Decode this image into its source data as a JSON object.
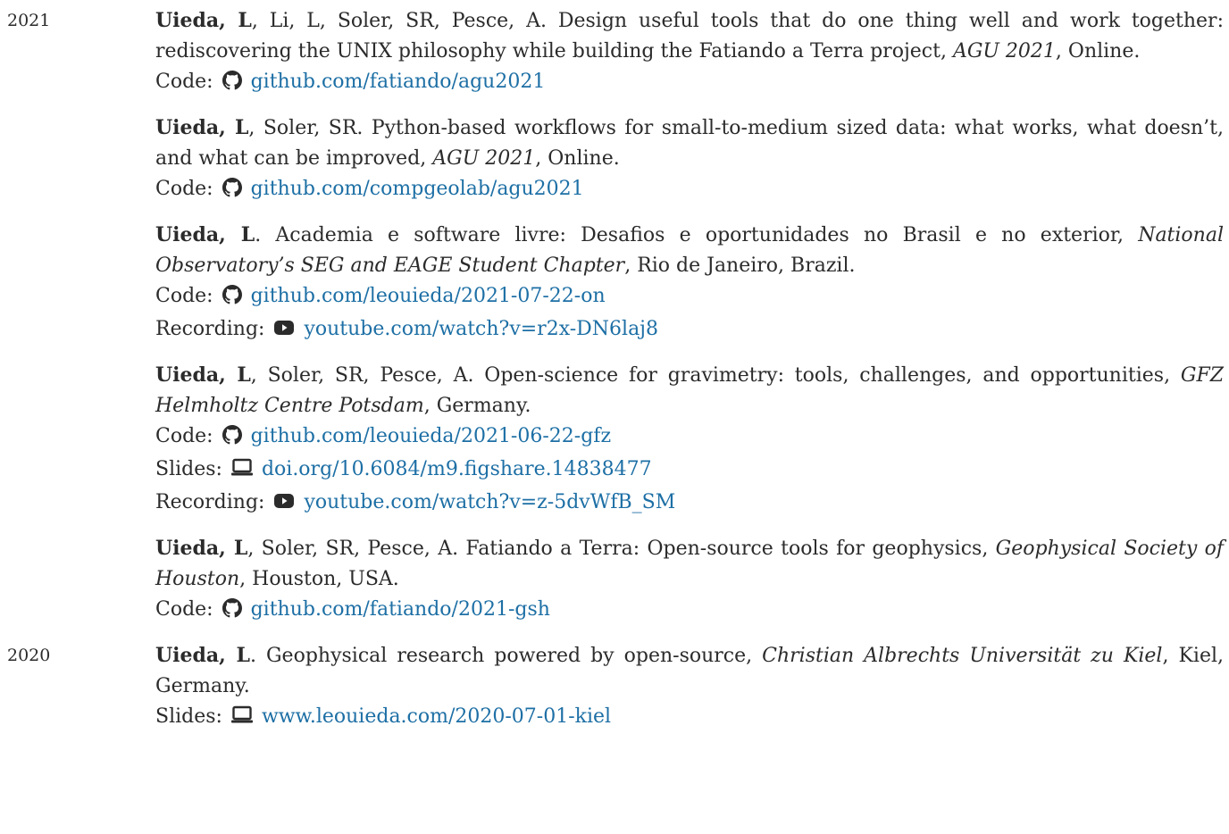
{
  "colors": {
    "link": "#1d6fa5",
    "text": "#2b2b2b"
  },
  "groups": [
    {
      "year": "2021",
      "entries": [
        {
          "author": "Uieda, L",
          "rest": ", Li, L, Soler, SR, Pesce, A. Design useful tools that do one thing well and work together: rediscovering the UNIX philosophy while building the Fatiando a Terra project, ",
          "venue": "AGU 2021",
          "after": ", Online.",
          "links": [
            {
              "label": "Code:",
              "icon": "github-icon",
              "url": "github.com/fatiando/agu2021"
            }
          ]
        },
        {
          "author": "Uieda, L",
          "rest": ", Soler, SR. Python-based workflows for small-to-medium sized data: what works, what doesn’t, and what can be improved, ",
          "venue": "AGU 2021",
          "after": ", Online.",
          "links": [
            {
              "label": "Code:",
              "icon": "github-icon",
              "url": "github.com/compgeolab/agu2021"
            }
          ]
        },
        {
          "author": "Uieda, L",
          "rest": ". Academia e software livre: Desafios e oportunidades no Brasil e no exterior, ",
          "venue": "National Observatory’s SEG and EAGE Student Chapter",
          "after": ", Rio de Janeiro, Brazil.",
          "links": [
            {
              "label": "Code:",
              "icon": "github-icon",
              "url": "github.com/leouieda/2021-07-22-on"
            },
            {
              "label": "Recording:",
              "icon": "youtube-icon",
              "url": "youtube.com/watch?v=r2x-DN6laj8"
            }
          ]
        },
        {
          "author": "Uieda, L",
          "rest": ", Soler, SR, Pesce, A. Open-science for gravimetry: tools, challenges, and opportunities, ",
          "venue": "GFZ Helmholtz Centre Potsdam",
          "after": ", Germany.",
          "links": [
            {
              "label": "Code:",
              "icon": "github-icon",
              "url": "github.com/leouieda/2021-06-22-gfz"
            },
            {
              "label": "Slides:",
              "icon": "monitor-icon",
              "url": "doi.org/10.6084/m9.figshare.14838477"
            },
            {
              "label": "Recording:",
              "icon": "youtube-icon",
              "url": "youtube.com/watch?v=z-5dvWfB_SM"
            }
          ]
        },
        {
          "author": "Uieda, L",
          "rest": ", Soler, SR, Pesce, A. Fatiando a Terra: Open-source tools for geophysics, ",
          "venue": "Geophysical Society of Houston",
          "after": ", Houston, USA.",
          "links": [
            {
              "label": "Code:",
              "icon": "github-icon",
              "url": "github.com/fatiando/2021-gsh"
            }
          ]
        }
      ]
    },
    {
      "year": "2020",
      "entries": [
        {
          "author": "Uieda, L",
          "rest": ". Geophysical research powered by open-source, ",
          "venue": "Christian Albrechts Universität zu Kiel",
          "after": ", Kiel, Germany.",
          "links": [
            {
              "label": "Slides:",
              "icon": "monitor-icon",
              "url": "www.leouieda.com/2020-07-01-kiel"
            }
          ]
        }
      ]
    }
  ]
}
